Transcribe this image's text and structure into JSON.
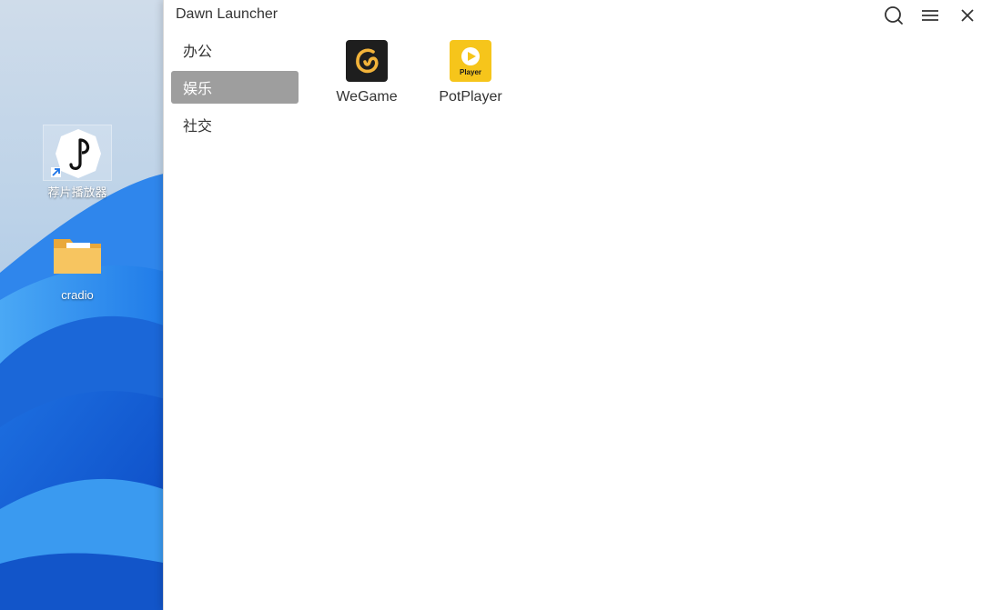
{
  "desktop": {
    "icons": [
      {
        "label": "荐片播放器"
      },
      {
        "label": "cradio"
      }
    ]
  },
  "window": {
    "title": "Dawn Launcher",
    "controls": {
      "search": "search-icon",
      "menu": "menu-icon",
      "close": "close-icon"
    }
  },
  "sidebar": {
    "categories": [
      {
        "label": "办公",
        "active": false
      },
      {
        "label": "娱乐",
        "active": true
      },
      {
        "label": "社交",
        "active": false
      }
    ]
  },
  "apps": [
    {
      "name": "WeGame",
      "icon": "wegame-icon"
    },
    {
      "name": "PotPlayer",
      "icon": "potplayer-icon",
      "icon_text": "Player"
    }
  ],
  "colors": {
    "active_category_bg": "#9e9e9e",
    "window_bg": "#ffffff",
    "text": "#333333",
    "potplayer_yellow": "#f6c51b",
    "wegame_bg": "#1e1e1e",
    "wegame_accent": "#f2b33a"
  }
}
